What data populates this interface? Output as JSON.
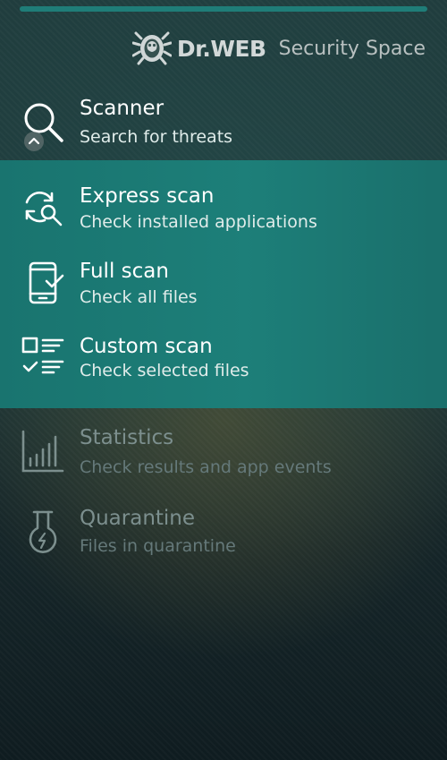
{
  "brand": {
    "name": "Dr.WEB",
    "product": "Security Space"
  },
  "menu": {
    "scanner": {
      "title": "Scanner",
      "subtitle": "Search for threats",
      "icon": "search-icon"
    },
    "express_scan": {
      "title": "Express scan",
      "subtitle": "Check installed applications",
      "icon": "refresh-search-icon"
    },
    "full_scan": {
      "title": "Full scan",
      "subtitle": "Check all files",
      "icon": "phone-check-icon"
    },
    "custom_scan": {
      "title": "Custom scan",
      "subtitle": "Check selected files",
      "icon": "checklist-icon"
    },
    "statistics": {
      "title": "Statistics",
      "subtitle": "Check results and app events",
      "icon": "bar-chart-icon"
    },
    "quarantine": {
      "title": "Quarantine",
      "subtitle": "Files in quarantine",
      "icon": "flask-icon"
    }
  },
  "colors": {
    "accent": "#1d7f79",
    "top_bar": "#1f7d78",
    "dim_text": "#7c8f8e"
  }
}
